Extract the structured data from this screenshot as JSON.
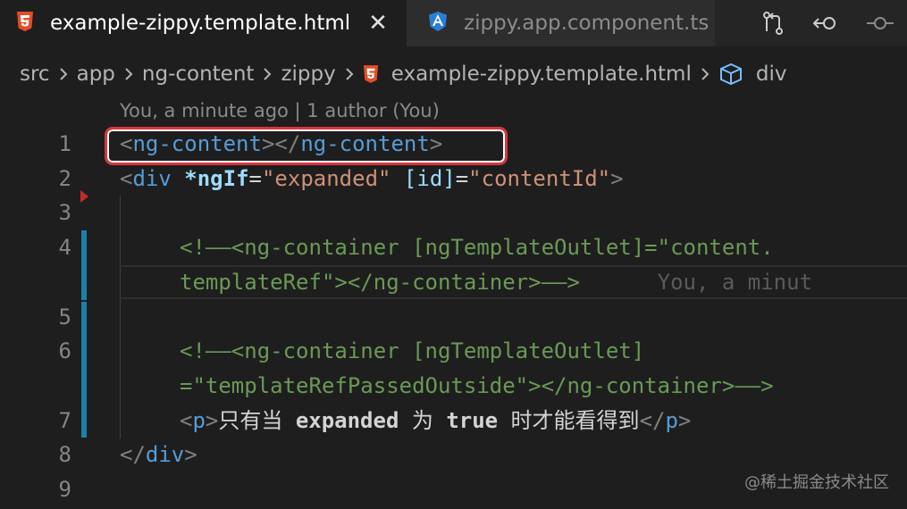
{
  "tabs": [
    {
      "label": "example-zippy.template.html",
      "icon": "html5-icon",
      "active": true
    },
    {
      "label": "zippy.app.component.ts",
      "icon": "angular-icon",
      "active": false
    }
  ],
  "toolbar": [
    "git-compare-icon",
    "go-back-icon",
    "go-forward-icon"
  ],
  "breadcrumb": {
    "items": [
      "src",
      "app",
      "ng-content",
      "zippy"
    ],
    "file": "example-zippy.template.html",
    "symbol": "div"
  },
  "blame": {
    "lens": "You, a minute ago | 1 author (You)",
    "inline": "You, a minut"
  },
  "gutter": {
    "line_numbers": [
      "1",
      "2",
      "3",
      "4",
      "5",
      "6",
      "7",
      "8",
      "9"
    ]
  },
  "code": {
    "l1": {
      "open_lt": "<",
      "tag": "ng-content",
      "gt": ">",
      "close_lt": "</",
      "close_tag": "ng-content",
      "close_gt": ">"
    },
    "l2": {
      "lt": "<",
      "tag": "div",
      "dir": "*ngIf",
      "eq1": "=",
      "val1": "\"expanded\"",
      "bind": "[id]",
      "eq2": "=",
      "val2": "\"contentId\"",
      "gt": ">"
    },
    "l4a": "<!——<ng-container [ngTemplateOutlet]=\"content.",
    "l4b": "templateRef\"></ng-container>——>",
    "l6a": "<!——<ng-container [ngTemplateOutlet]",
    "l6b": "=\"templateRefPassedOutside\"></ng-container>——>",
    "l7": {
      "lt": "<",
      "tag": "p",
      "gt": ">",
      "t1": "只有当 ",
      "b1": "expanded",
      "t2": " 为 ",
      "b2": "true",
      "t3": " 时才能看得到",
      "close_lt": "</",
      "close_tag": "p",
      "close_gt": ">"
    },
    "l8": {
      "close_lt": "</",
      "close_tag": "div",
      "close_gt": ">"
    }
  },
  "watermark": "@稀土掘金技术社区",
  "colors": {
    "accent_git": "#1b81a8",
    "highlight_box": "#d8363d",
    "html5": "#e44d26",
    "angular": "#2a7fd4"
  }
}
